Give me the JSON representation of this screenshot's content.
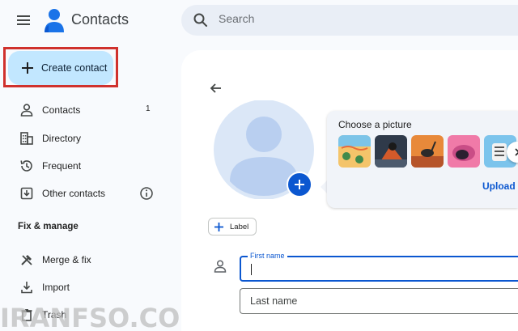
{
  "app": {
    "title": "Contacts",
    "menu_icon": "hamburger-menu-icon",
    "logo_icon": "contacts-person-logo"
  },
  "search": {
    "placeholder": "Search",
    "icon": "search-icon"
  },
  "sidebar": {
    "create_label": "Create contact",
    "items": [
      {
        "label": "Contacts",
        "count": "1",
        "icon": "person-icon"
      },
      {
        "label": "Directory",
        "icon": "building-icon"
      },
      {
        "label": "Frequent",
        "icon": "history-icon"
      },
      {
        "label": "Other contacts",
        "icon": "download-box-icon",
        "extra_icon": "info-icon"
      }
    ],
    "section_title": "Fix & manage",
    "manage_items": [
      {
        "label": "Merge & fix",
        "icon": "tools-icon"
      },
      {
        "label": "Import",
        "icon": "import-icon"
      },
      {
        "label": "Trash",
        "icon": "trash-icon"
      }
    ]
  },
  "editor": {
    "picker_title": "Choose a picture",
    "upload_label": "Upload",
    "label_chip": "Label",
    "first_name_label": "First name",
    "last_name_placeholder": "Last name"
  },
  "watermark": "IRANFSO.COM",
  "colors": {
    "accent": "#0b57d0",
    "create_bg": "#c2e7ff",
    "highlight": "#d0312d"
  }
}
